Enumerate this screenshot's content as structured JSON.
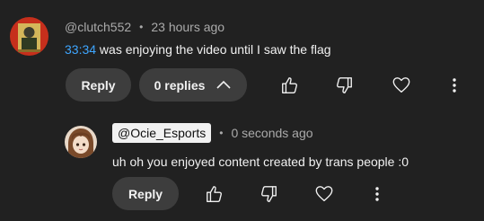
{
  "comment": {
    "author": "@clutch552",
    "time_ago": "23 hours ago",
    "timestamp": "33:34",
    "text": " was enjoying the video until I saw the flag",
    "reply_label": "Reply",
    "replies_label": "0 replies",
    "separator": "•"
  },
  "reply": {
    "author": "@Ocie_Esports",
    "time_ago": "0 seconds ago",
    "text": "uh oh you enjoyed content created by trans people :0",
    "reply_label": "Reply",
    "separator": "•"
  },
  "icons": {
    "like": "thumbs-up-icon",
    "dislike": "thumbs-down-icon",
    "heart": "heart-icon",
    "more": "more-vertical-icon",
    "collapse": "chevron-up-icon"
  },
  "colors": {
    "background": "#212121",
    "button": "#3d3d3d",
    "link": "#3ea6ff",
    "secondary_text": "#aaaaaa",
    "primary_text": "#f1f1f1"
  }
}
